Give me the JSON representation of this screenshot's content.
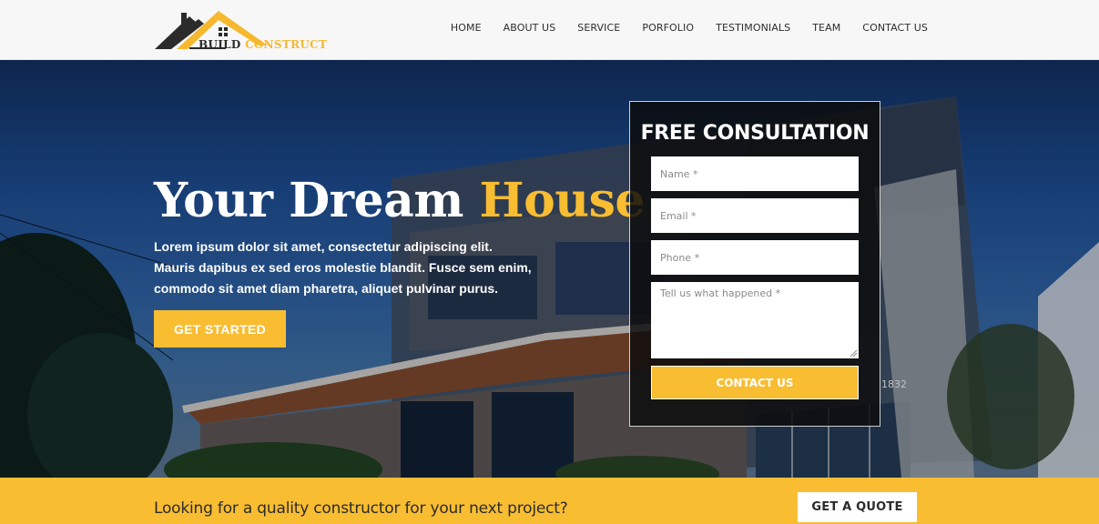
{
  "brand": {
    "logo_word1": "BUILD",
    "logo_word2": "CONSTRUCT",
    "colors": {
      "accent": "#f9bd32",
      "dark": "#2b2b2b"
    }
  },
  "nav": {
    "items": [
      {
        "label": "HOME"
      },
      {
        "label": "ABOUT US"
      },
      {
        "label": "SERVICE"
      },
      {
        "label": "PORFOLIO"
      },
      {
        "label": "TESTIMONIALS"
      },
      {
        "label": "TEAM"
      },
      {
        "label": "CONTACT US"
      }
    ]
  },
  "hero": {
    "title_main": "Your Dream ",
    "title_accent": "House",
    "text": "Lorem ipsum dolor sit amet, consectetur adipiscing elit. Mauris dapibus ex sed eros molestie blandit. Fusce sem enim, commodo sit amet diam pharetra, aliquet pulvinar purus.",
    "cta_label": "GET STARTED",
    "house_number": "1832"
  },
  "form": {
    "title": "FREE CONSULTATION",
    "name_placeholder": "Name *",
    "email_placeholder": "Email *",
    "phone_placeholder": "Phone *",
    "message_placeholder": "Tell us what happened *",
    "submit_label": "CONTACT US"
  },
  "cta_bar": {
    "text": "Looking for a quality constructor for your next project?",
    "button_label": "GET A QUOTE"
  }
}
